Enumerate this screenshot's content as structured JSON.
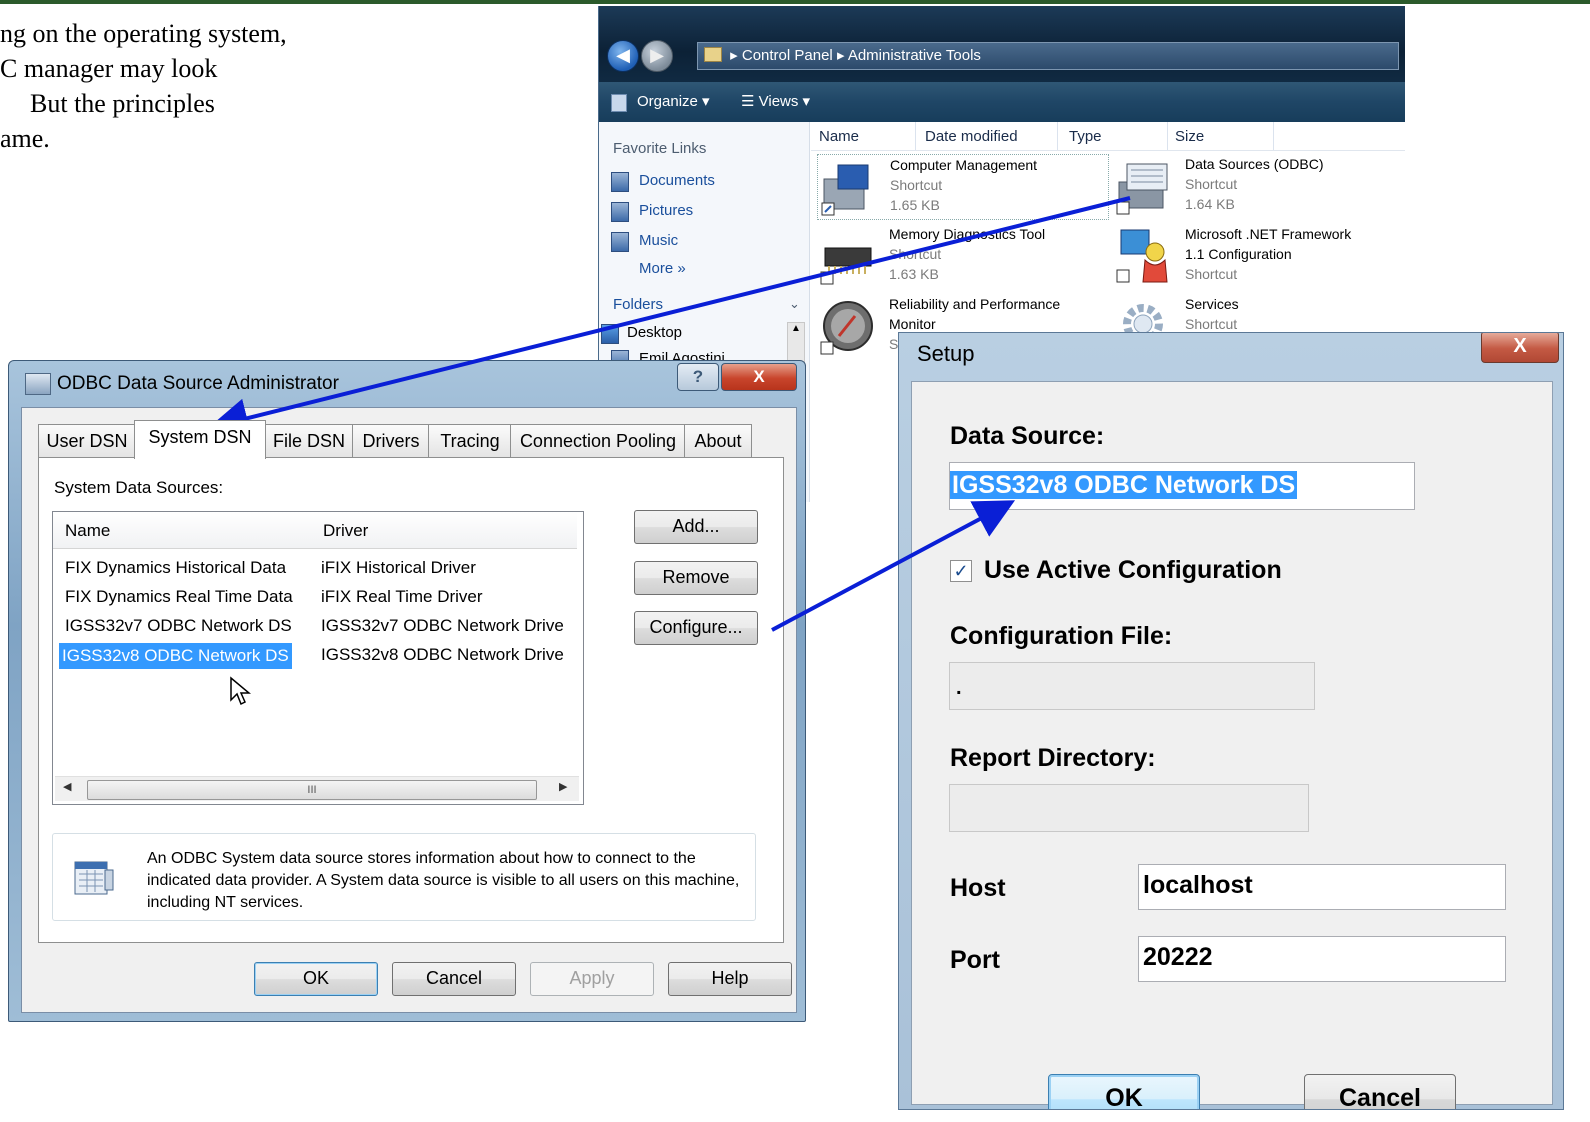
{
  "slide": {
    "lines": [
      "ng on the operating system,",
      "C manager may look",
      "But the principles",
      "ame."
    ]
  },
  "explorer": {
    "breadcrumb": [
      "Control Panel",
      "Administrative Tools"
    ],
    "toolbar": {
      "organize": "Organize",
      "views": "Views"
    },
    "favorite_links_header": "Favorite Links",
    "favorite_links": [
      "Documents",
      "Pictures",
      "Music"
    ],
    "more_link": "More",
    "folders_header": "Folders",
    "folder_tree": [
      "Desktop",
      "Emil Agostini"
    ],
    "columns": [
      "Name",
      "Date modified",
      "Type",
      "Size"
    ],
    "files": [
      {
        "name": "Computer Management",
        "type": "Shortcut",
        "size": "1.65 KB"
      },
      {
        "name": "Data Sources (ODBC)",
        "type": "Shortcut",
        "size": "1.64 KB"
      },
      {
        "name": "Memory Diagnostics Tool",
        "type": "Shortcut",
        "size": "1.63 KB"
      },
      {
        "name": "Microsoft .NET Framework",
        "name2": "1.1 Configuration",
        "type": "Shortcut"
      },
      {
        "name": "Reliability and Performance",
        "name2": "Monitor",
        "type": "Sh"
      },
      {
        "name": "Services",
        "type": "Shortcut"
      }
    ]
  },
  "odbc": {
    "title": "ODBC Data Source Administrator",
    "help_glyph": "?",
    "close_glyph": "X",
    "tabs": [
      "User DSN",
      "System DSN",
      "File DSN",
      "Drivers",
      "Tracing",
      "Connection Pooling",
      "About"
    ],
    "section_label": "System Data Sources:",
    "list_columns": [
      "Name",
      "Driver"
    ],
    "rows": [
      {
        "name": "FIX Dynamics Historical Data",
        "driver": "iFIX Historical Driver"
      },
      {
        "name": "FIX Dynamics Real Time Data",
        "driver": "iFIX Real Time Driver"
      },
      {
        "name": "IGSS32v7 ODBC Network DS",
        "driver": "IGSS32v7 ODBC Network Drive"
      },
      {
        "name": "IGSS32v8 ODBC Network DS",
        "driver": "IGSS32v8 ODBC Network Drive"
      }
    ],
    "selected_row": 3,
    "scroll_thumb_glyph": "III",
    "side_buttons": {
      "add": "Add...",
      "remove": "Remove",
      "configure": "Configure..."
    },
    "info_text": "An ODBC System data source stores information about how to connect to the indicated data provider.   A System data source is visible to all users on this machine, including NT services.",
    "footer_buttons": {
      "ok": "OK",
      "cancel": "Cancel",
      "apply": "Apply",
      "help": "Help"
    }
  },
  "setup": {
    "title": "Setup",
    "close_glyph": "X",
    "data_source_label": "Data Source:",
    "data_source_value": "IGSS32v8 ODBC Network DS",
    "use_active_config_label": "Use Active Configuration",
    "use_active_config_checked": true,
    "config_file_label": "Configuration File:",
    "config_file_value": ".",
    "report_dir_label": "Report Directory:",
    "report_dir_value": "",
    "host_label": "Host",
    "host_value": "localhost",
    "port_label": "Port",
    "port_value": "20222",
    "ok_button": "OK",
    "cancel_button": "Cancel"
  },
  "colors": {
    "arrow": "#0a1fd6",
    "selection": "#3399ff",
    "accent_bar": "#2b5a2b"
  }
}
